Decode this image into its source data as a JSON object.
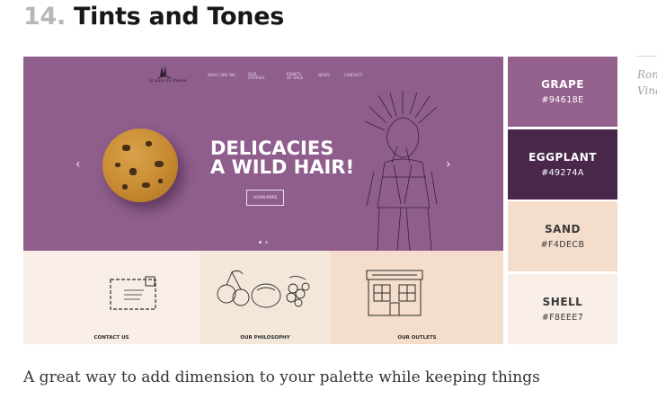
{
  "heading": {
    "number": "14.",
    "title": "Tints and Tones"
  },
  "sidebar": {
    "line1": "Ron",
    "line2": "Vinc"
  },
  "mockup": {
    "logo_text": "la paix du fleuve",
    "nav": [
      "WHAT ARE WE",
      "OUR STORIES",
      "POINTS OF SALE",
      "NEWS",
      "CONTACT"
    ],
    "headline_line1": "DELICACIES",
    "headline_line2": "A WILD HAIR!",
    "learn_more": "LEARN MORE",
    "arrow_left": "‹",
    "arrow_right": "›",
    "cards": [
      {
        "label": "CONTACT US"
      },
      {
        "label": "OUR PHILOSOPHY"
      },
      {
        "label": "OUR OUTLETS"
      }
    ]
  },
  "palette": [
    {
      "name": "GRAPE",
      "hex": "#94618E",
      "color": "#94618E",
      "text_color": "#ffffff"
    },
    {
      "name": "EGGPLANT",
      "hex": "#49274A",
      "color": "#49274A",
      "text_color": "#ffffff"
    },
    {
      "name": "SAND",
      "hex": "#F4DECB",
      "color": "#F4DECB",
      "text_color": "#3a3a3a"
    },
    {
      "name": "SHELL",
      "hex": "#F8EEE7",
      "color": "#F8EEE7",
      "text_color": "#3a3a3a"
    }
  ],
  "paragraph": "A great way to add dimension to your palette while keeping things"
}
